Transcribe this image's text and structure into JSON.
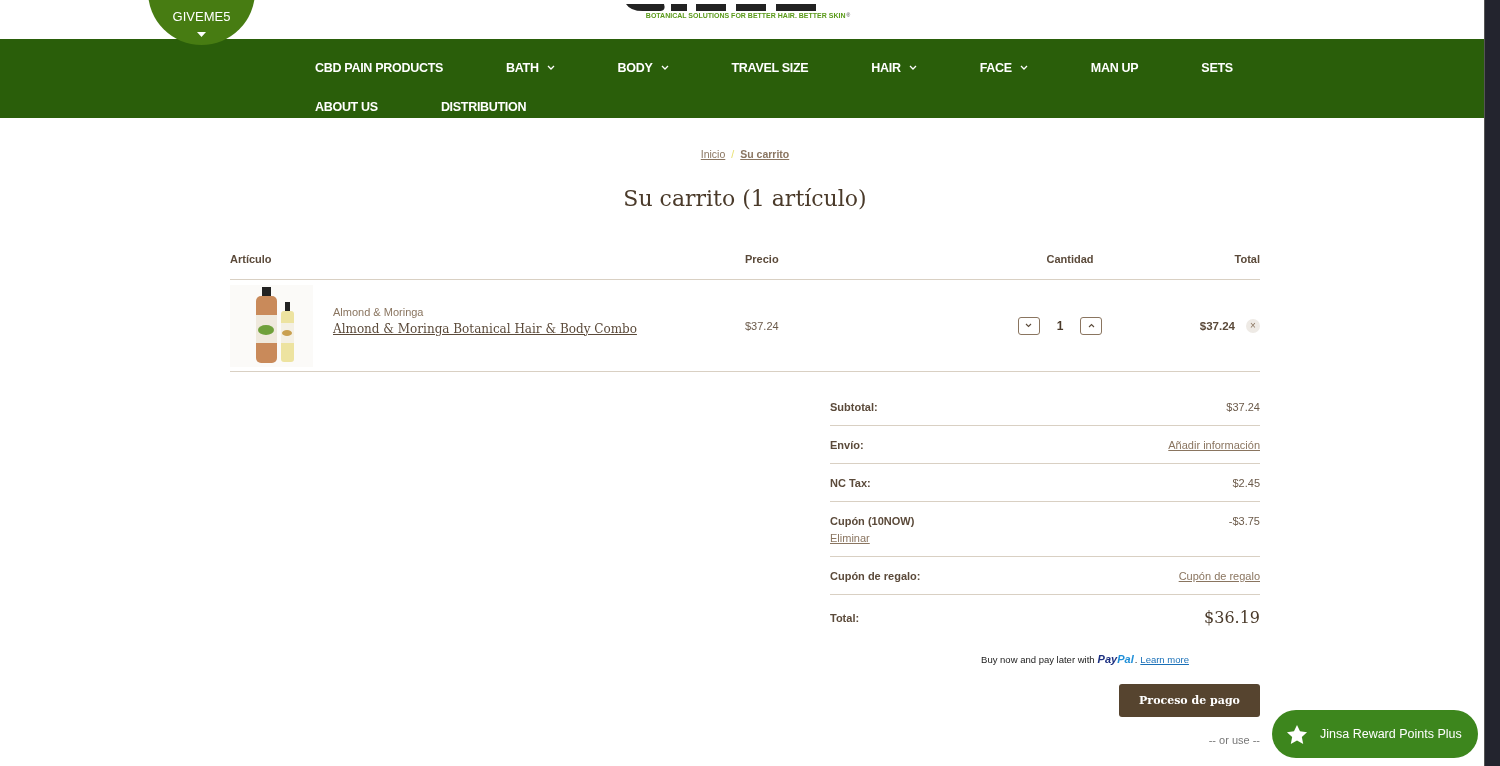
{
  "promo_badge": {
    "code": "GIVEME5"
  },
  "logo": {
    "tagline": "BOTANICAL SOLUTIONS FOR BETTER HAIR. BETTER SKIN",
    "mark": "®"
  },
  "nav": [
    {
      "label": "CBD PAIN PRODUCTS",
      "dropdown": false
    },
    {
      "label": "BATH",
      "dropdown": true
    },
    {
      "label": "BODY",
      "dropdown": true
    },
    {
      "label": "TRAVEL SIZE",
      "dropdown": false
    },
    {
      "label": "HAIR",
      "dropdown": true
    },
    {
      "label": "FACE",
      "dropdown": true
    },
    {
      "label": "MAN UP",
      "dropdown": false
    },
    {
      "label": "SETS",
      "dropdown": false
    },
    {
      "label": "ABOUT US",
      "dropdown": false
    },
    {
      "label": "DISTRIBUTION",
      "dropdown": false
    }
  ],
  "breadcrumb": [
    {
      "label": "Inicio",
      "current": false
    },
    {
      "label": "Su carrito",
      "current": true
    }
  ],
  "breadcrumb_separator": "/",
  "title": "Su carrito (1 artículo)",
  "table": {
    "columns": [
      "Artículo",
      "Precio",
      "Cantidad",
      "Total"
    ],
    "rows": [
      {
        "brand": "Almond & Moringa",
        "name": "Almond & Moringa Botanical Hair & Body Combo",
        "price": "$37.24",
        "quantity": "1",
        "total": "$37.24",
        "remove": "×"
      }
    ]
  },
  "summary": [
    {
      "kind": "value",
      "label": "Subtotal:",
      "value": "$37.24"
    },
    {
      "kind": "link",
      "label": "Envío:",
      "value": "Añadir información"
    },
    {
      "kind": "value",
      "label": "NC Tax:",
      "value": "$2.45"
    },
    {
      "kind": "coupon",
      "label": "Cupón (10NOW)",
      "value": "-$3.75",
      "action": "Eliminar"
    },
    {
      "kind": "link",
      "label": "Cupón de regalo:",
      "value": "Cupón de regalo"
    },
    {
      "kind": "total",
      "label": "Total:",
      "value": "$36.19"
    }
  ],
  "paypal": {
    "text": "Buy now and pay later with",
    "brand_a": "Pay",
    "brand_b": "Pal",
    "dot": ".",
    "link": "Learn more"
  },
  "checkout_button": "Proceso de pago",
  "alt_divider": "-- or use --",
  "rewards_button": "Jinsa Reward Points Plus"
}
